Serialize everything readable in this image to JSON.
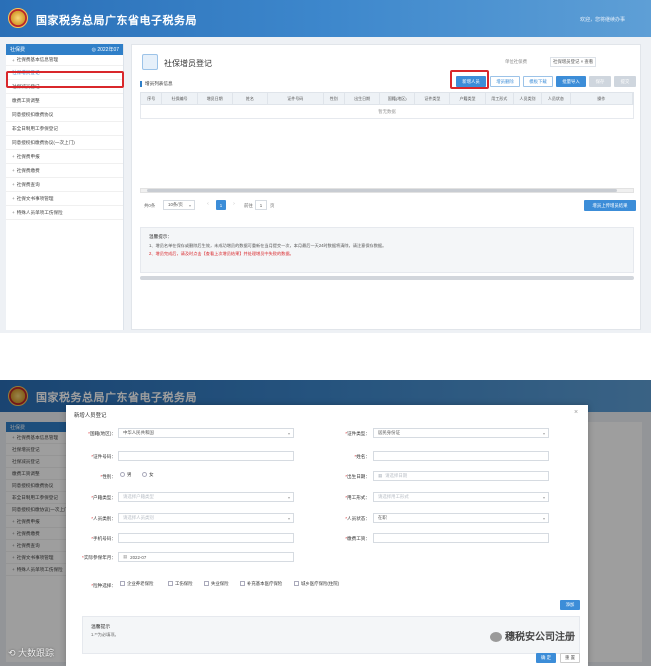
{
  "top": {
    "app_title": "国家税务总局广东省电子税务局",
    "user_text": "欢迎，您将继续办事",
    "page_title": "社保增员登记",
    "crumb1": "单位社保费",
    "crumb2": "社保增员登记",
    "crumb3": "× 查看",
    "section_label": "增员列表信息",
    "btn_add": "新增人员",
    "btn_delete": "增员删除",
    "btn_tpl": "模板下载",
    "btn_import": "批量导入",
    "btn_submit": "保存",
    "btn_cancel": "提交",
    "columns": [
      "序号",
      "社保编号",
      "增员日期",
      "姓名",
      "证件号码",
      "性别",
      "出生日期",
      "国籍(地区)",
      "证件类型",
      "户籍类型",
      "用工形式",
      "人员类别",
      "人员状态",
      "操作"
    ],
    "empty_text": "暂无数据",
    "pager_total": "共0条",
    "pager_size": "10条/页",
    "pager_current": "1",
    "pager_goto": "前往",
    "pager_goto_value": "1",
    "pager_page": "页",
    "btn_upload": "增员上传增员结果",
    "tips_title": "温馨提示：",
    "tip1": "1、增员名单在保存或删除后生效，未成功增员的数据可重新在当月提交一次，本月最后一天24时数据将清除，请注意保存数据。",
    "tip2": "2、增员完成后，请及时点击【查看上次增员结果】并处理增员中失败的数据。"
  },
  "sidebar": {
    "head_label": "社保费",
    "head_right": "◎ 2022年07",
    "items": [
      {
        "label": "社保费基本信息管理",
        "group": true
      },
      {
        "label": "社保增员登记",
        "group": false
      },
      {
        "label": "社保减员登记",
        "group": false
      },
      {
        "label": "缴费工资调整",
        "group": false
      },
      {
        "label": "同意授权扣缴费协议",
        "group": false
      },
      {
        "label": "非全日制用工参保登记",
        "group": false
      },
      {
        "label": "同意授权扣缴费协议(一次上门)",
        "group": false
      },
      {
        "label": "社保费申报",
        "group": true
      },
      {
        "label": "社保费缴费",
        "group": true
      },
      {
        "label": "社保费查询",
        "group": true
      },
      {
        "label": "社保文书事项管理",
        "group": true
      },
      {
        "label": "特殊人员单项工伤保险",
        "group": true
      }
    ]
  },
  "header2": {
    "app_title": "国家税务总局广东省电子税务局",
    "side_items": [
      "社保费",
      "社保费基本信息管理",
      "社保增员登记",
      "社保减员登记",
      "缴费工资调整",
      "同意授权扣缴费协议",
      "非全日制用工参保登记",
      "同意授权扣缴协议(一次上门)",
      "社保费申报",
      "社保费缴费",
      "社保费查询",
      "社保文书事项管理",
      "特殊人员单项工伤保险"
    ]
  },
  "modal": {
    "title": "新增人员登记",
    "close": "×",
    "fields": {
      "nationality_label": "国籍(地区)：",
      "nationality_value": "中华人民共和国",
      "idtype_label": "证件类型：",
      "idtype_value": "居民身份证",
      "idno_label": "证件号码：",
      "name_label": "姓名：",
      "gender_label": "性别：",
      "gender_male": "男",
      "gender_female": "女",
      "birth_label": "出生日期：",
      "birth_ph": "请选择日期",
      "hukou_label": "户籍类型：",
      "hukou_ph": "请选择户籍类型",
      "employ_label": "用工形式：",
      "employ_ph": "请选择用工形式",
      "category_label": "人员类别：",
      "category_ph": "请选择人员类别",
      "status_label": "人员状态：",
      "status_value": "在职",
      "mobile_label": "手机号码：",
      "wage_label": "缴费工资：",
      "start_label": "实际参保年月：",
      "start_value": "2022-07",
      "insurance_label": "险种选择：",
      "ins1": "企业养老保险",
      "ins2": "工伤保险",
      "ins3": "失业保险",
      "ins4": "补充基本医疗保险",
      "ins5": "城乡医疗保险(住院)"
    },
    "btn_add_row": "添加",
    "tips_title": "温馨提示",
    "tips_text": "1.**为必填项。",
    "btn_ok": "确 定",
    "btn_reset": "重 置"
  },
  "watermarks": {
    "left": "大数跟踪",
    "right": "穗税安公司注册"
  }
}
